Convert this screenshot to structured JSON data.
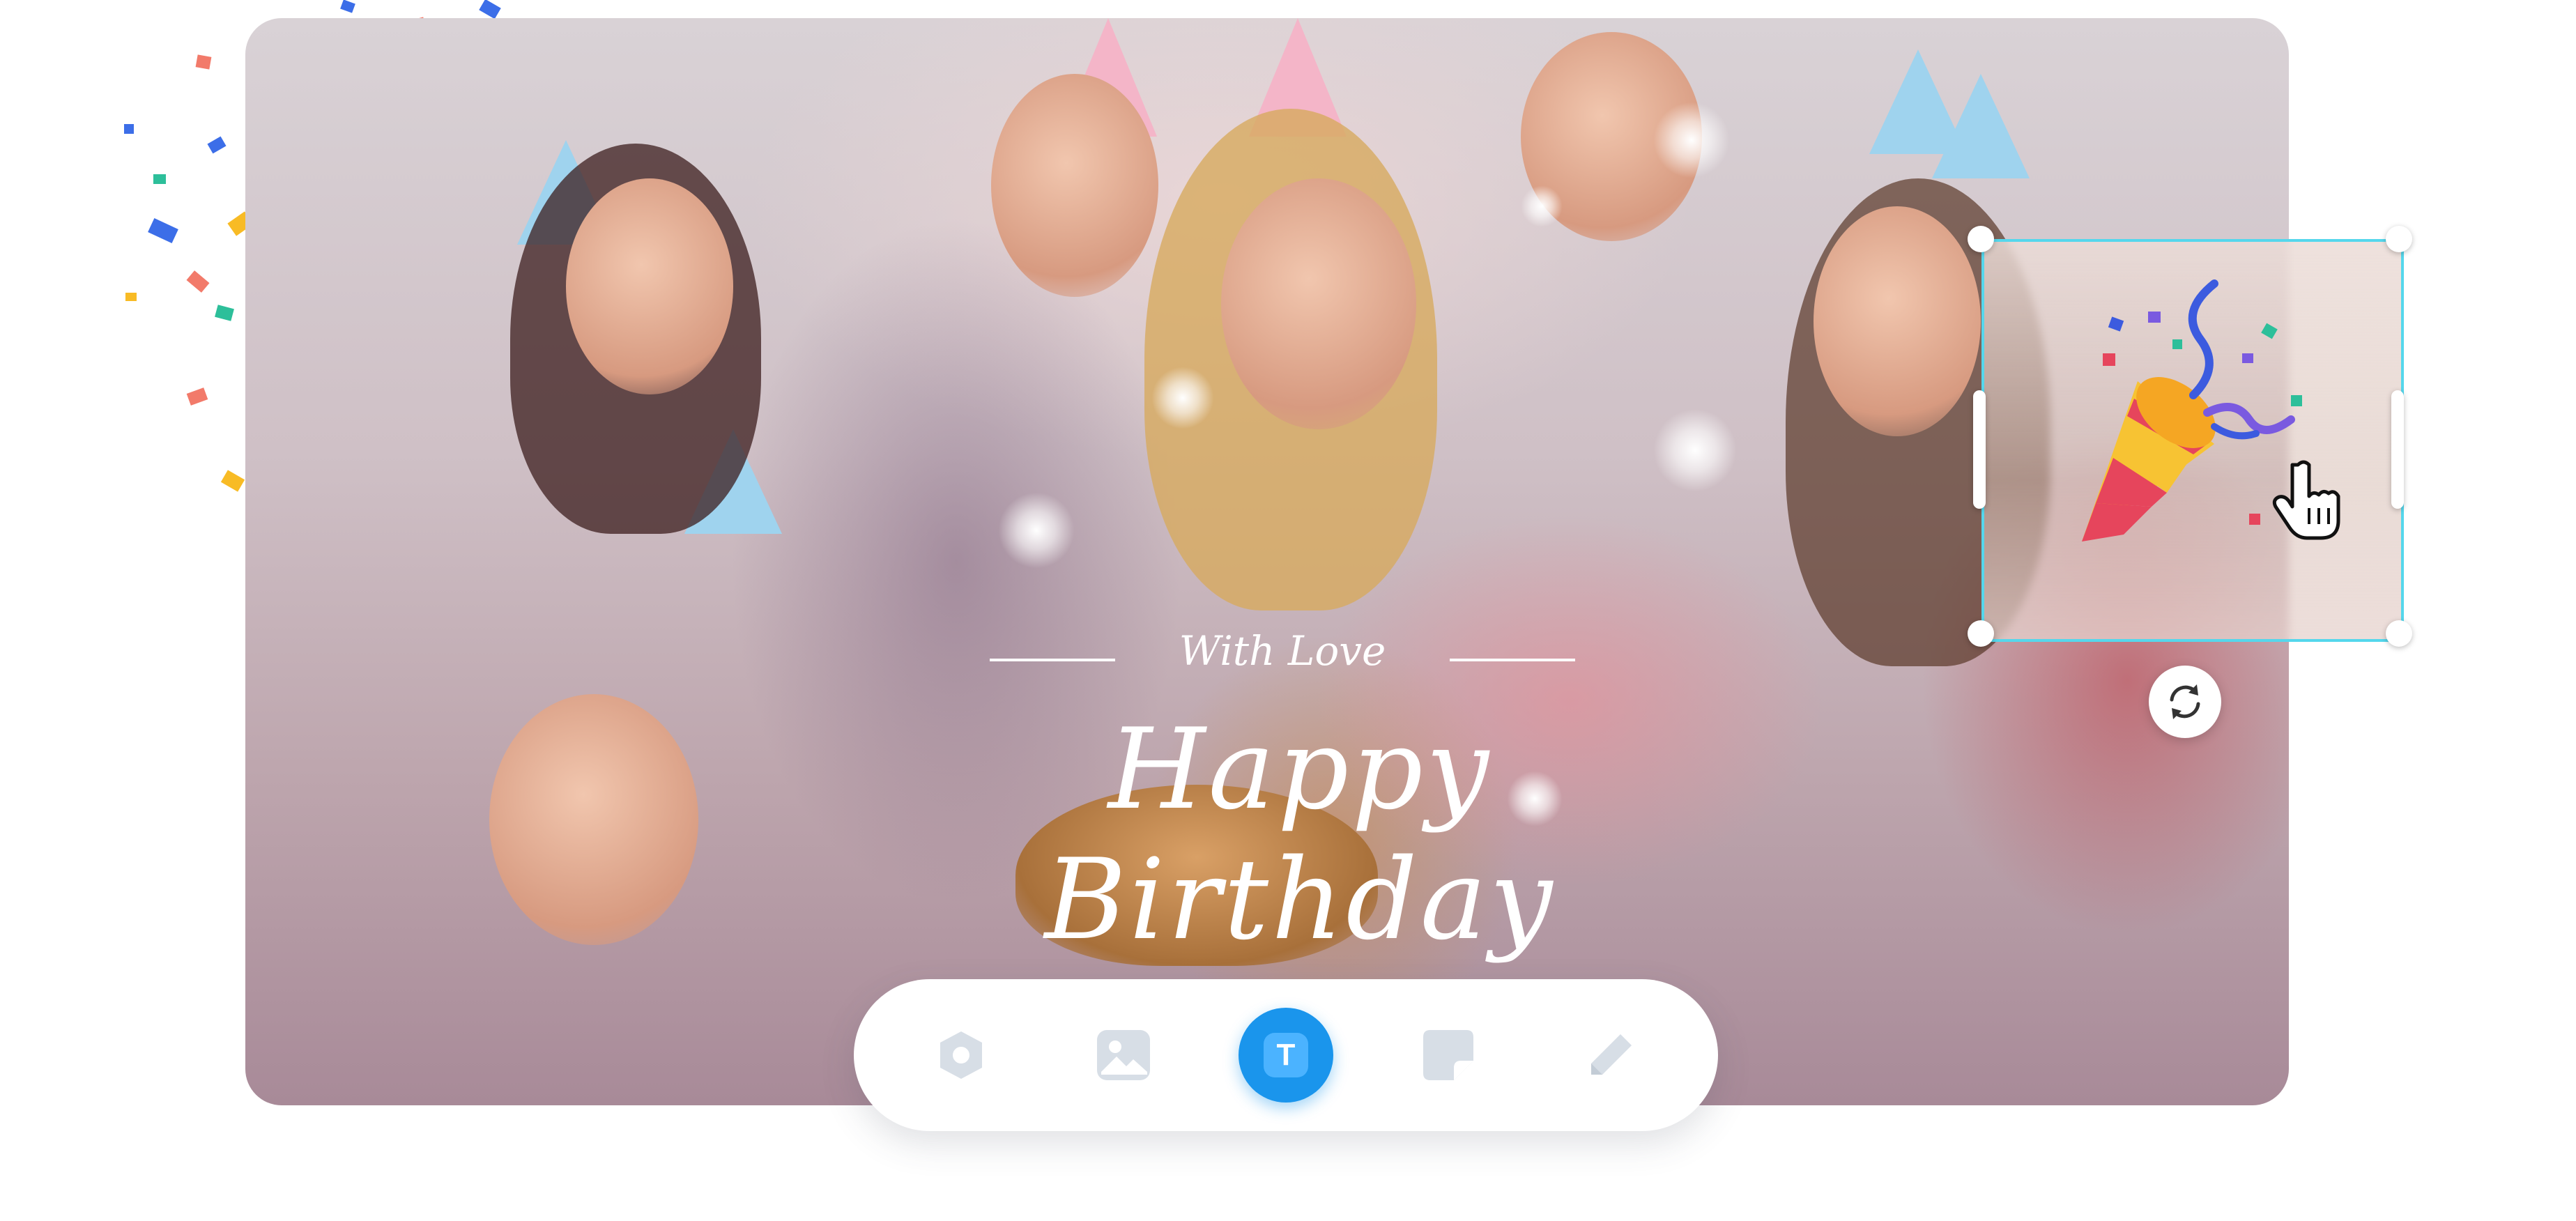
{
  "canvas": {
    "headline_small": "With Love",
    "headline_large": "Happy Birthday"
  },
  "sticker": {
    "icon": "party-popper-icon",
    "selection_color": "#55d7ec"
  },
  "toolbar": {
    "tools": [
      {
        "name": "shape-tool",
        "icon": "hexagon-icon",
        "active": false
      },
      {
        "name": "image-tool",
        "icon": "image-icon",
        "active": false
      },
      {
        "name": "text-tool",
        "icon": "text-T-icon",
        "active": true,
        "label": "T"
      },
      {
        "name": "sticker-tool",
        "icon": "sticker-note-icon",
        "active": false
      },
      {
        "name": "draw-tool",
        "icon": "pencil-icon",
        "active": false
      }
    ],
    "accent_color": "#1a95ec"
  }
}
